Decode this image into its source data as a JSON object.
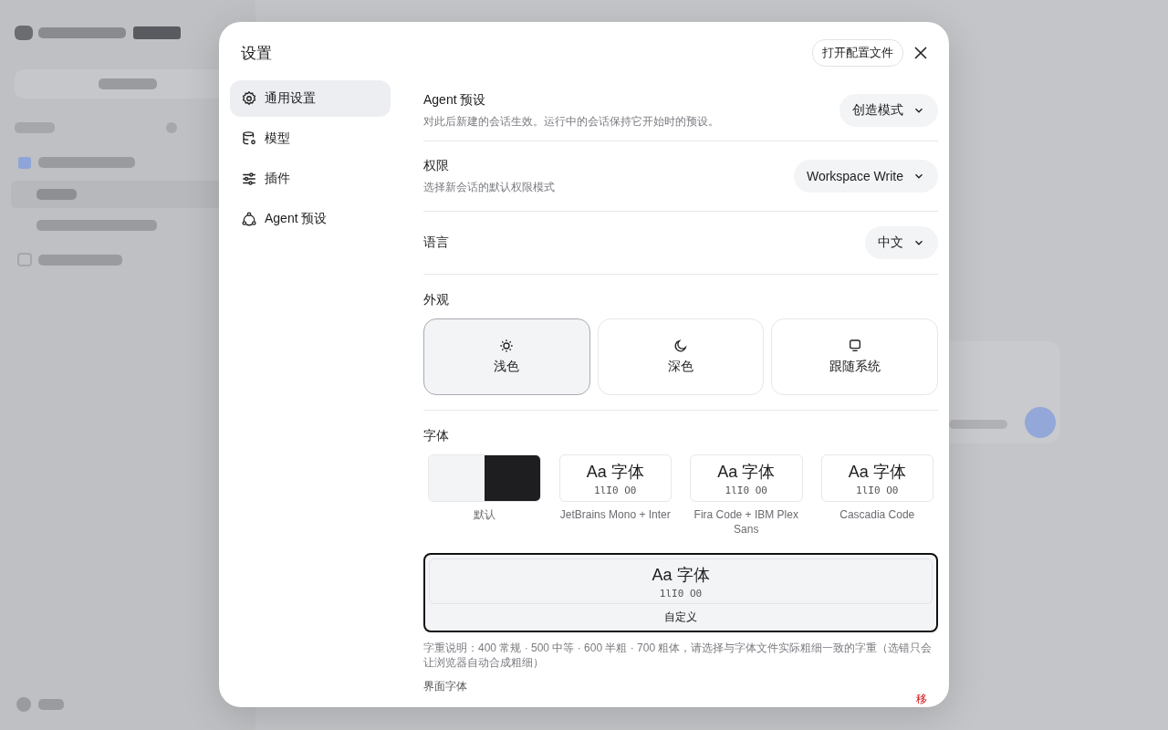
{
  "dialog": {
    "title": "设置",
    "open_config_button": "打开配置文件"
  },
  "nav": [
    {
      "label": "通用设置",
      "selected": true
    },
    {
      "label": "模型",
      "selected": false
    },
    {
      "label": "插件",
      "selected": false
    },
    {
      "label": "Agent 预设",
      "selected": false
    }
  ],
  "settings": [
    {
      "label": "Agent 预设",
      "description": "对此后新建的会话生效。运行中的会话保持它开始时的预设。",
      "value": "创造模式"
    },
    {
      "label": "权限",
      "description": "选择新会话的默认权限模式",
      "value": "Workspace Write"
    },
    {
      "label": "语言",
      "value": "中文"
    }
  ],
  "appearance": {
    "label": "外观",
    "options": [
      {
        "label": "浅色",
        "selected": true
      },
      {
        "label": "深色",
        "selected": false
      },
      {
        "label": "跟随系统",
        "selected": false
      }
    ]
  },
  "fonts": {
    "label": "字体",
    "options": [
      {
        "kind": "swatch",
        "label": "默认",
        "selected": false
      },
      {
        "kind": "sample",
        "sample": "Aa 字体",
        "code": "1lI0 O0",
        "label": "JetBrains Mono + Inter",
        "selected": false
      },
      {
        "kind": "sample",
        "sample": "Aa 字体",
        "code": "1lI0 O0",
        "label": "Fira Code + IBM Plex Sans",
        "selected": false
      },
      {
        "kind": "sample",
        "sample": "Aa 字体",
        "code": "1lI0 O0",
        "label": "Cascadia Code",
        "selected": false
      },
      {
        "kind": "wide",
        "sample": "Aa 字体",
        "code": "1lI0 O0",
        "label": "自定义",
        "selected": true
      }
    ],
    "weight_note": "字重说明：400 常规 · 500 中等 · 600 半粗 · 700 粗体，请选择与字体文件实际粗细一致的字重（选错只会让浏览器自动合成粗细）",
    "ui_font_label": "界面字体",
    "remove_button": "移"
  }
}
